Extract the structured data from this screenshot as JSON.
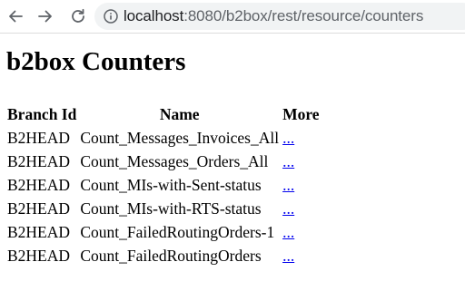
{
  "browser": {
    "url_host": "localhost",
    "url_rest": ":8080/b2box/rest/resource/counters"
  },
  "page": {
    "title": "b2box Counters"
  },
  "table": {
    "headers": [
      "Branch Id",
      "Name",
      "More"
    ],
    "rows": [
      {
        "branch": "B2HEAD",
        "name": "Count_Messages_Invoices_All",
        "more": "..."
      },
      {
        "branch": "B2HEAD",
        "name": "Count_Messages_Orders_All",
        "more": "..."
      },
      {
        "branch": "B2HEAD",
        "name": "Count_MIs-with-Sent-status",
        "more": "..."
      },
      {
        "branch": "B2HEAD",
        "name": "Count_MIs-with-RTS-status",
        "more": "..."
      },
      {
        "branch": "B2HEAD",
        "name": "Count_FailedRoutingOrders-1",
        "more": "..."
      },
      {
        "branch": "B2HEAD",
        "name": "Count_FailedRoutingOrders",
        "more": "..."
      }
    ]
  }
}
